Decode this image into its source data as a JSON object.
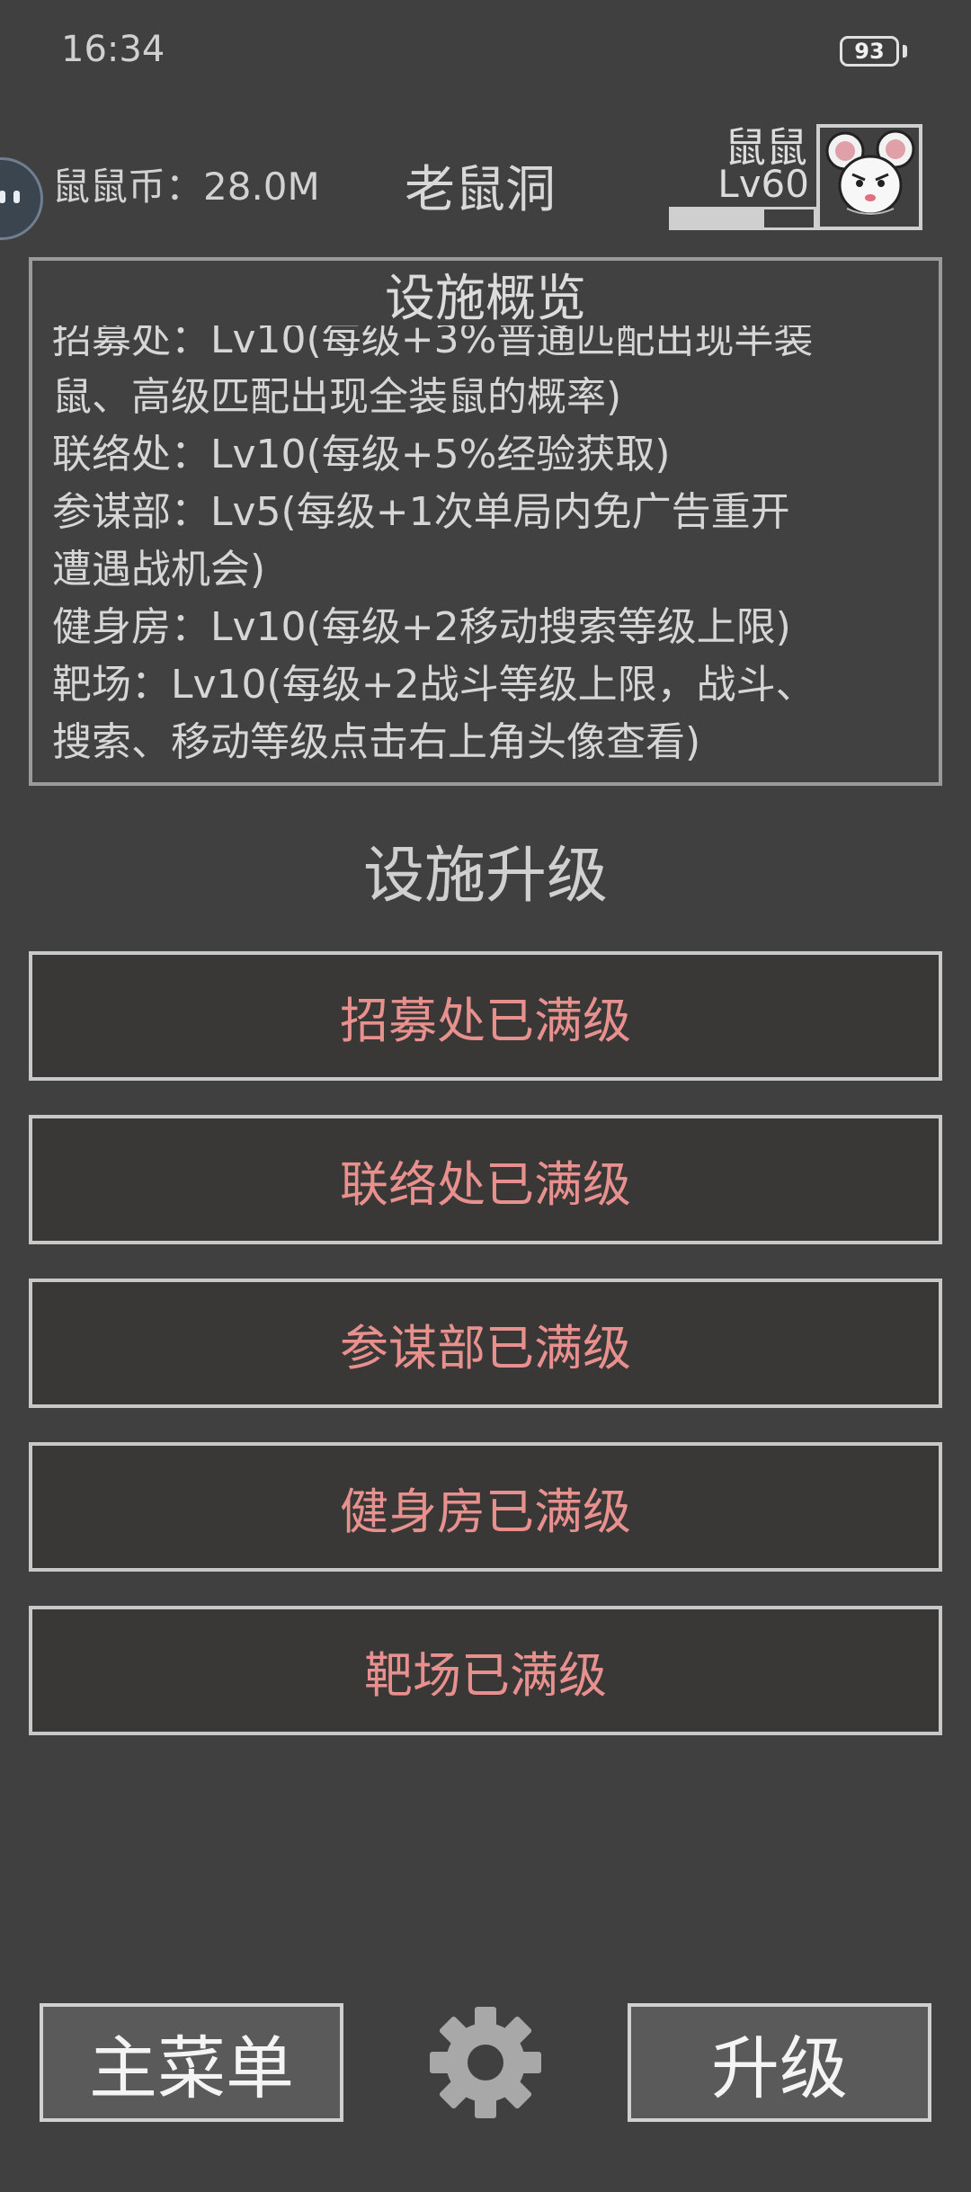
{
  "status_bar": {
    "time": "16:34",
    "battery": "93"
  },
  "header": {
    "coins_label": "鼠鼠币：28.0M",
    "title": "老鼠洞",
    "player_name": "鼠鼠",
    "player_level": "Lv60",
    "xp_progress": 0.65
  },
  "overview": {
    "title": "设施概览",
    "lines": [
      "招募处：Lv10(每级+3%普通匹配出现半装",
      "鼠、高级匹配出现全装鼠的概率)",
      "联络处：Lv10(每级+5%经验获取)",
      "参谋部：Lv5(每级+1次单局内免广告重开",
      "遭遇战机会)",
      "健身房：Lv10(每级+2移动搜索等级上限)",
      "靶场：Lv10(每级+2战斗等级上限，战斗、",
      "搜索、移动等级点击右上角头像查看)"
    ]
  },
  "upgrade": {
    "title": "设施升级",
    "buttons": [
      "招募处已满级",
      "联络处已满级",
      "参谋部已满级",
      "健身房已满级",
      "靶场已满级"
    ]
  },
  "bottom_bar": {
    "main_menu": "主菜单",
    "upgrade": "升级",
    "settings_icon": "gear-icon"
  }
}
